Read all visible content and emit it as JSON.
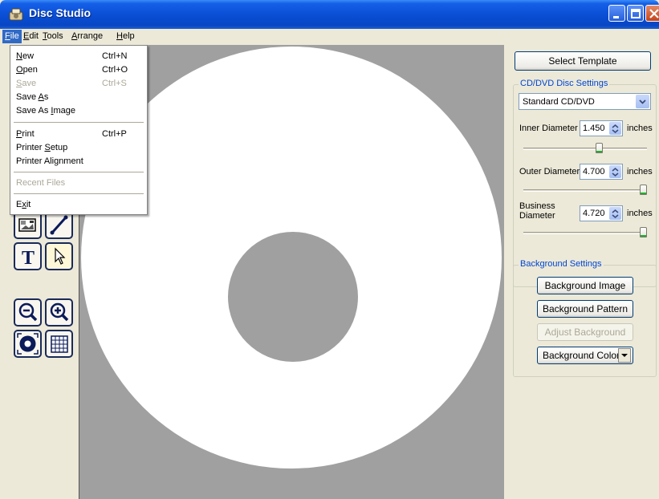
{
  "window": {
    "title": "Disc Studio"
  },
  "menubar": [
    {
      "pre": "",
      "ul": "F",
      "post": "ile"
    },
    {
      "pre": "",
      "ul": "E",
      "post": "dit"
    },
    {
      "pre": "",
      "ul": "T",
      "post": "ools"
    },
    {
      "pre": "",
      "ul": "A",
      "post": "rrange"
    },
    {
      "pre": "",
      "ul": "H",
      "post": "elp"
    }
  ],
  "file_menu": [
    {
      "pre": "",
      "ul": "N",
      "post": "ew",
      "shortcut": "Ctrl+N",
      "disabled": false
    },
    {
      "pre": "",
      "ul": "O",
      "post": "pen",
      "shortcut": "Ctrl+O",
      "disabled": false
    },
    {
      "pre": "",
      "ul": "S",
      "post": "ave",
      "shortcut": "Ctrl+S",
      "disabled": true
    },
    {
      "pre": "Save ",
      "ul": "A",
      "post": "s",
      "shortcut": "",
      "disabled": false
    },
    {
      "pre": "Save As ",
      "ul": "I",
      "post": "mage",
      "shortcut": "",
      "disabled": false
    },
    {
      "pre": "",
      "ul": "P",
      "post": "rint",
      "shortcut": "Ctrl+P",
      "disabled": false
    },
    {
      "pre": "Printer ",
      "ul": "S",
      "post": "etup",
      "shortcut": "",
      "disabled": false
    },
    {
      "pre": "Printer Alignment",
      "ul": "",
      "post": "",
      "shortcut": "",
      "disabled": false
    },
    {
      "pre": "Recent Files",
      "ul": "",
      "post": "",
      "shortcut": "",
      "disabled": true
    },
    {
      "pre": "E",
      "ul": "x",
      "post": "it",
      "shortcut": "",
      "disabled": false
    }
  ],
  "tools": [
    {
      "name": "image-tool",
      "icon": "image-icon"
    },
    {
      "name": "line-tool",
      "icon": "line-icon"
    },
    {
      "name": "text-tool",
      "icon": "text-icon"
    },
    {
      "name": "select-tool",
      "icon": "pointer-icon"
    },
    {
      "name": "zoom-out-tool",
      "icon": "zoom-out-icon"
    },
    {
      "name": "zoom-in-tool",
      "icon": "zoom-in-icon"
    },
    {
      "name": "disc-view-tool",
      "icon": "disc-icon"
    },
    {
      "name": "grid-tool",
      "icon": "grid-icon"
    }
  ],
  "panel": {
    "select_template": "Select Template",
    "disc_settings": {
      "title": "CD/DVD Disc Settings",
      "disc_type": "Standard CD/DVD",
      "inner_diameter": {
        "label": "Inner Diameter",
        "value": "1.450",
        "unit": "inches",
        "slider_level": 0.62
      },
      "outer_diameter": {
        "label": "Outer Diameter",
        "value": "4.700",
        "unit": "inches",
        "slider_level": 1.0
      },
      "business_diameter": {
        "label_line1": "Business",
        "label_line2": "Diameter",
        "value": "4.720",
        "unit": "inches",
        "slider_level": 1.0
      }
    },
    "background_settings": {
      "title": "Background Settings",
      "background_image": "Background Image",
      "background_pattern": "Background Pattern",
      "adjust_background": "Adjust Background",
      "background_color": "Background Color"
    }
  },
  "colors": {
    "canvas_gray": "#A0A0A0",
    "disc_white": "#FFFFFF",
    "xp_blue": "#0A4FD6",
    "menu_highlight": "#316AC5",
    "group_title": "#0046D5"
  }
}
